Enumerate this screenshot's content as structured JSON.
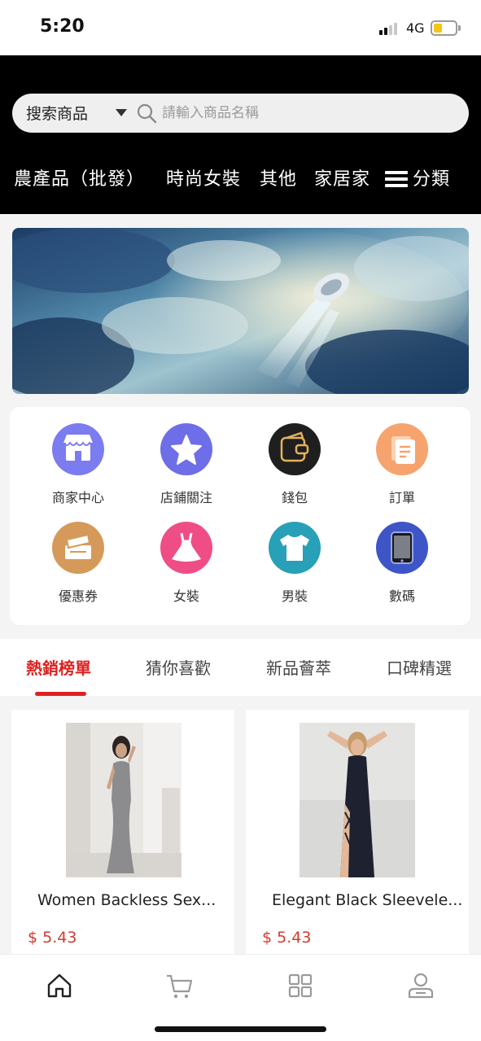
{
  "status_bar": {
    "time": "5:20",
    "network": "4G",
    "battery_level": 0.4
  },
  "search": {
    "category": "搜索商品",
    "placeholder": "請輸入商品名稱"
  },
  "categories": [
    "農產品（批發）",
    "時尚女裝",
    "其他",
    "家居家"
  ],
  "category_menu_label": "分類",
  "shortcuts": [
    {
      "label": "商家中心",
      "icon": "store-icon",
      "color": "#7b7cf0"
    },
    {
      "label": "店鋪關注",
      "icon": "star-icon",
      "color": "#6e6ee8"
    },
    {
      "label": "錢包",
      "icon": "wallet-icon",
      "color": "#1f1f1f"
    },
    {
      "label": "訂單",
      "icon": "order-icon",
      "color": "#f6a36e"
    },
    {
      "label": "優惠券",
      "icon": "coupon-icon",
      "color": "#d59a59"
    },
    {
      "label": "女裝",
      "icon": "dress-icon",
      "color": "#ef4d86"
    },
    {
      "label": "男裝",
      "icon": "tshirt-icon",
      "color": "#27a0b8"
    },
    {
      "label": "數碼",
      "icon": "tablet-icon",
      "color": "#3d55c6"
    }
  ],
  "tabs": [
    {
      "label": "熱銷榜單",
      "active": true
    },
    {
      "label": "猜你喜歡",
      "active": false
    },
    {
      "label": "新品薈萃",
      "active": false
    },
    {
      "label": "口碑精選",
      "active": false
    }
  ],
  "products": [
    {
      "name": "Women Backless Sex...",
      "price": "$ 5.43"
    },
    {
      "name": "Elegant Black Sleevele...",
      "price": "$ 5.43"
    }
  ],
  "bottom_nav": [
    "home-icon",
    "cart-icon",
    "category-grid-icon",
    "user-icon"
  ],
  "colors": {
    "accent": "#e02020",
    "price": "#d43a2f",
    "header_bg": "#000000"
  }
}
